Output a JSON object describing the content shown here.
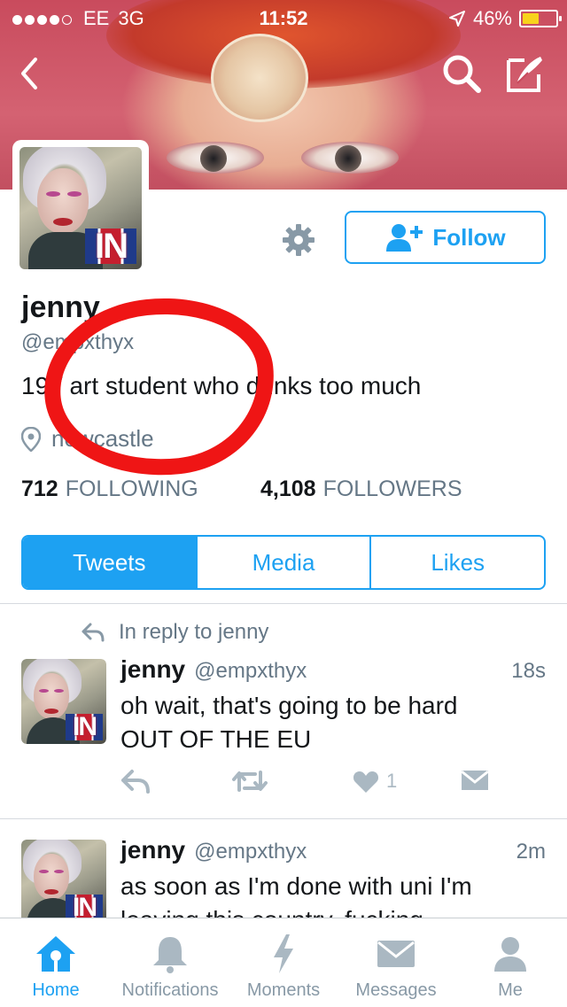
{
  "status_bar": {
    "carrier": "EE",
    "network": "3G",
    "time": "11:52",
    "battery": "46%"
  },
  "header": {
    "back_icon": "chevron-left-icon",
    "search_icon": "search-icon",
    "compose_icon": "compose-icon"
  },
  "profile": {
    "name": "jenny",
    "handle": "@empxthyx",
    "bio": "19 / art student who drinks too much",
    "location": "newcastle",
    "following_count": "712",
    "following_label": "FOLLOWING",
    "followers_count": "4,108",
    "followers_label": "FOLLOWERS",
    "follow_label": "Follow",
    "avatar_overlay": "IN"
  },
  "tabs": {
    "tweets": "Tweets",
    "media": "Media",
    "likes": "Likes"
  },
  "tweets": [
    {
      "reply_context": "In reply to jenny",
      "name": "jenny",
      "handle": "@empxthyx",
      "time": "18s",
      "text_line1": "oh wait, that's going to be hard",
      "text_line2": "OUT OF THE EU",
      "likes": "1"
    },
    {
      "name": "jenny",
      "handle": "@empxthyx",
      "time": "2m",
      "text_line1": "as soon as I'm done with uni I'm",
      "text_line2": "leaving this country, fucking"
    }
  ],
  "tabbar": {
    "home": "Home",
    "notifications": "Notifications",
    "moments": "Moments",
    "messages": "Messages",
    "me": "Me"
  },
  "colors": {
    "accent": "#1da1f2",
    "annotation": "#ef1515"
  }
}
